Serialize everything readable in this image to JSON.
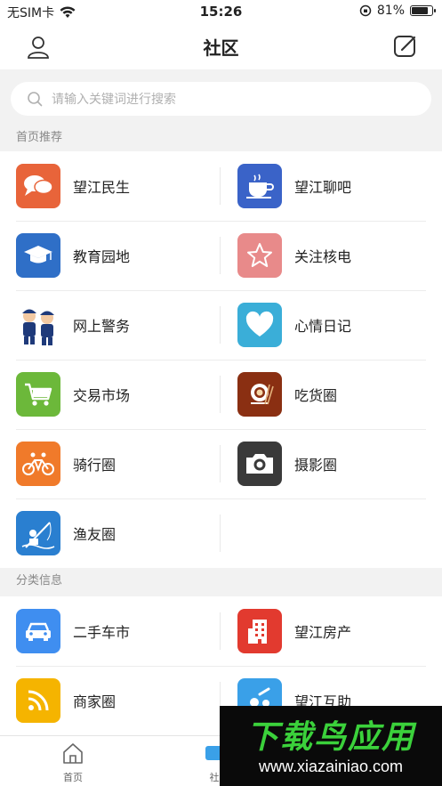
{
  "status_bar": {
    "carrier": "无SIM卡",
    "time": "15:26",
    "battery": "81%",
    "battery_level": 0.81
  },
  "nav": {
    "title": "社区",
    "icons": {
      "left": "user-icon",
      "right": "compose-icon"
    }
  },
  "search": {
    "placeholder": "请输入关键词进行搜索"
  },
  "sections": [
    {
      "title": "首页推荐",
      "items": [
        {
          "label": "望江民生",
          "icon": "chat-bubbles-icon",
          "color": "#e8643a"
        },
        {
          "label": "望江聊吧",
          "icon": "coffee-cup-icon",
          "color": "#3a63c8"
        },
        {
          "label": "教育园地",
          "icon": "graduation-cap-icon",
          "color": "#2f6fc7"
        },
        {
          "label": "关注核电",
          "icon": "star-icon",
          "color": "#e88a8a"
        },
        {
          "label": "网上警务",
          "icon": "police-icon",
          "color": "#ffffff"
        },
        {
          "label": "心情日记",
          "icon": "heart-icon",
          "color": "#3aaed8"
        },
        {
          "label": "交易市场",
          "icon": "cart-icon",
          "color": "#6cb83a"
        },
        {
          "label": "吃货圈",
          "icon": "dish-icon",
          "color": "#8a2f12"
        },
        {
          "label": "骑行圈",
          "icon": "bicycle-icon",
          "color": "#f07a2a"
        },
        {
          "label": "摄影圈",
          "icon": "camera-icon",
          "color": "#3a3a3a"
        },
        {
          "label": "渔友圈",
          "icon": "fishing-icon",
          "color": "#2a7fd0"
        }
      ]
    },
    {
      "title": "分类信息",
      "items": [
        {
          "label": "二手车市",
          "icon": "car-icon",
          "color": "#3f8ef0"
        },
        {
          "label": "望江房产",
          "icon": "building-icon",
          "color": "#e23a2f"
        },
        {
          "label": "商家圈",
          "icon": "rss-icon",
          "color": "#f5b400"
        },
        {
          "label": "望江互助",
          "icon": "help-icon",
          "color": "#3aa0e8"
        }
      ]
    }
  ],
  "tab_bar": [
    {
      "label": "首页",
      "icon": "home-icon"
    },
    {
      "label": "社",
      "icon": "community-icon"
    }
  ],
  "watermark": {
    "title": "下载鸟应用",
    "url": "www.xiazainiao.com"
  }
}
